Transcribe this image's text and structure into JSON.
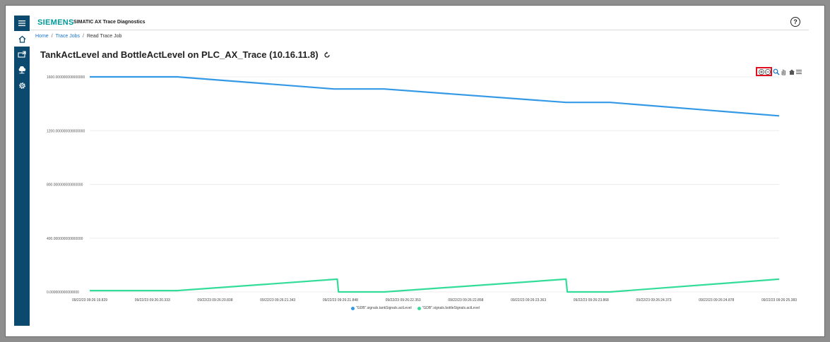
{
  "app": {
    "brand": "SIEMENS",
    "product": "SIMATIC AX Trace Diagnostics",
    "help_glyph": "?"
  },
  "sidebar": {
    "items": [
      {
        "name": "menu",
        "icon": "hamburger-icon"
      },
      {
        "name": "home",
        "icon": "home-icon"
      },
      {
        "name": "trace-jobs",
        "icon": "export-icon"
      },
      {
        "name": "cloud",
        "icon": "cloud-icon"
      },
      {
        "name": "settings",
        "icon": "gear-icon"
      }
    ]
  },
  "breadcrumb": {
    "items": [
      "Home",
      "Trace Jobs",
      "Read Trace Job"
    ],
    "separator": "/"
  },
  "page": {
    "title": "TankActLevel and BottleActLevel on PLC_AX_Trace (10.16.11.8)"
  },
  "chart_toolbar": {
    "icons": [
      "zoom-in-icon",
      "zoom-out-icon",
      "selection-zoom-icon",
      "pan-hand-icon",
      "reset-home-icon",
      "chart-menu-icon"
    ]
  },
  "colors": {
    "sidebar": "#0b4a6e",
    "brand": "#009999",
    "link": "#1a73c9",
    "tank_series": "#3399e6",
    "bottle_series": "#33dd99",
    "highlight": "#e01020"
  },
  "chart_data": {
    "type": "line",
    "ylim": [
      0,
      1600
    ],
    "y_ticks": [
      {
        "value": 1600,
        "label": "1600.000000000000000"
      },
      {
        "value": 1200,
        "label": "1200.000000000000000"
      },
      {
        "value": 800,
        "label": "800.000000000000000"
      },
      {
        "value": 400,
        "label": "400.000000000000000"
      },
      {
        "value": 0,
        "label": "0.000000000000000"
      }
    ],
    "x_ticks": [
      "09/22/23 09:26:19.829",
      "09/22/23 09:26:20.333",
      "09/22/23 09:26:20.838",
      "09/22/23 09:26:21.343",
      "09/22/23 09:26:21.848",
      "09/22/23 09:26:22.353",
      "09/22/23 09:26:22.858",
      "09/22/23 09:26:23.363",
      "09/22/23 09:26:23.868",
      "09/22/23 09:26:24.373",
      "09/22/23 09:26:24.878",
      "09/22/23 09:26:25.383"
    ],
    "xlim": [
      0,
      11
    ],
    "series": [
      {
        "name": "\"GDB\".signals.tankSignals.actLevel",
        "color": "#3399e6",
        "points": [
          [
            0,
            1600
          ],
          [
            1.4,
            1600
          ],
          [
            3.9,
            1510
          ],
          [
            4.7,
            1510
          ],
          [
            7.6,
            1410
          ],
          [
            8.3,
            1410
          ],
          [
            11,
            1310
          ]
        ]
      },
      {
        "name": "\"GDB\".signals.bottleSignals.actLevel",
        "color": "#33dd99",
        "points": [
          [
            0,
            10
          ],
          [
            1.4,
            10
          ],
          [
            3.95,
            95
          ],
          [
            3.97,
            0
          ],
          [
            4.7,
            0
          ],
          [
            7.6,
            95
          ],
          [
            7.62,
            0
          ],
          [
            8.3,
            0
          ],
          [
            11,
            95
          ]
        ]
      }
    ],
    "grid": true,
    "legend_position": "bottom-center"
  }
}
